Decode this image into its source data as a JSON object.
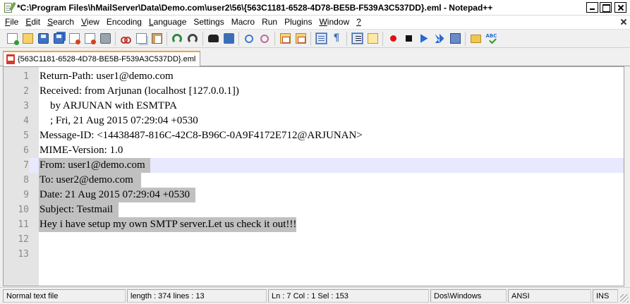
{
  "window": {
    "title": "*C:\\Program Files\\hMailServer\\Data\\Demo.com\\user2\\56\\{563C1181-6528-4D78-BE5B-F539A3C537DD}.eml - Notepad++"
  },
  "menu": [
    {
      "accel": "F",
      "rest": "ile"
    },
    {
      "accel": "E",
      "rest": "dit"
    },
    {
      "accel": "S",
      "rest": "earch"
    },
    {
      "accel": "V",
      "rest": "iew"
    },
    {
      "accel": "",
      "rest": "Encoding"
    },
    {
      "accel": "L",
      "rest": "anguage"
    },
    {
      "accel": "",
      "rest": "Settings"
    },
    {
      "accel": "",
      "rest": "Macro"
    },
    {
      "accel": "",
      "rest": "Run"
    },
    {
      "accel": "",
      "rest": "Plugins"
    },
    {
      "accel": "W",
      "rest": "indow"
    },
    {
      "accel": "?",
      "rest": ""
    }
  ],
  "toolbar": {
    "icons": [
      "new-file-icon",
      "open-file-icon",
      "save-icon",
      "save-all-icon",
      "close-file-icon",
      "close-all-icon",
      "print-icon",
      "cut-icon",
      "copy-icon",
      "paste-icon",
      "undo-icon",
      "redo-icon",
      "find-icon",
      "replace-icon",
      "zoom-in-icon",
      "zoom-out-icon",
      "sync-vertical-icon",
      "sync-horizontal-icon",
      "word-wrap-icon",
      "show-all-characters-icon",
      "indent-guide-icon",
      "user-defined-language-icon",
      "record-macro-icon",
      "stop-recording-icon",
      "playback-macro-icon",
      "run-macro-multiple-icon",
      "save-macro-icon",
      "folder-icon",
      "spell-check-icon"
    ]
  },
  "tabs": [
    {
      "label": "{563C1181-6528-4D78-BE5B-F539A3C537DD}.eml",
      "active": true,
      "modified": true
    }
  ],
  "editor": {
    "current_line": 7,
    "lines": [
      {
        "n": "1",
        "text": "Return-Path: user1@demo.com",
        "selected": false
      },
      {
        "n": "2",
        "text": "Received: from Arjunan (localhost [127.0.0.1])",
        "selected": false
      },
      {
        "n": "3",
        "text": "    by ARJUNAN with ESMTPA",
        "selected": false
      },
      {
        "n": "4",
        "text": "    ; Fri, 21 Aug 2015 07:29:04 +0530",
        "selected": false
      },
      {
        "n": "5",
        "text": "Message-ID: <14438487-816C-42C8-B96C-0A9F4172E712@ARJUNAN>",
        "selected": false
      },
      {
        "n": "6",
        "text": "MIME-Version: 1.0",
        "selected": false
      },
      {
        "n": "7",
        "text": "From: user1@demo.com  ",
        "selected": true
      },
      {
        "n": "8",
        "text": "To: user2@demo.com   ",
        "selected": true
      },
      {
        "n": "9",
        "text": "Date: 21 Aug 2015 07:29:04 +0530  ",
        "selected": true
      },
      {
        "n": "10",
        "text": "Subject: Testmail  ",
        "selected": true
      },
      {
        "n": "11",
        "text": "Hey i have setup my own SMTP server.Let us check it out!!!",
        "selected": true
      },
      {
        "n": "12",
        "text": "",
        "selected": false
      },
      {
        "n": "13",
        "text": "",
        "selected": false
      }
    ]
  },
  "status": {
    "file_type": "Normal text file",
    "length_lines": "length : 374    lines : 13",
    "cursor": "Ln : 7    Col : 1    Sel : 153",
    "eol": "Dos\\Windows",
    "encoding": "ANSI",
    "mode": "INS"
  },
  "colors": {
    "selection": "#c0c0c0",
    "current_line": "#e8e8ff",
    "gutter": "#e4e4e4",
    "active_tab_accent": "#f5a030"
  }
}
